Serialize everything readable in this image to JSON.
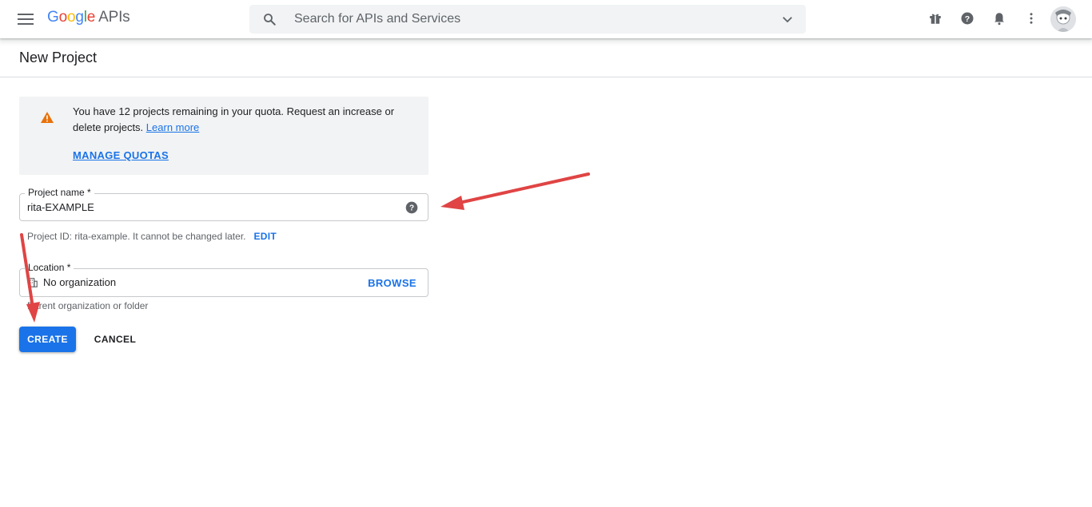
{
  "topbar": {
    "logo_letters": [
      "G",
      "o",
      "o",
      "g",
      "l",
      "e"
    ],
    "logo_suffix": "APIs",
    "search_placeholder": "Search for APIs and Services",
    "icons": [
      "menu-icon",
      "search-icon",
      "chevron-down-icon",
      "gift-icon",
      "help-icon",
      "notifications-icon",
      "more-vert-icon"
    ]
  },
  "page": {
    "title": "New Project"
  },
  "quota": {
    "message": "You have 12 projects remaining in your quota. Request an increase or delete projects.",
    "learn_more": "Learn more",
    "manage_quotas": "MANAGE QUOTAS"
  },
  "project_name": {
    "label": "Project name *",
    "value": "rita-EXAMPLE",
    "hint": "Project ID: rita-example. It cannot be changed later.",
    "edit": "EDIT"
  },
  "location": {
    "label": "Location *",
    "value": "No organization",
    "browse": "BROWSE",
    "hint": "Parent organization or folder"
  },
  "actions": {
    "create": "CREATE",
    "cancel": "CANCEL"
  },
  "colors": {
    "accent": "#1a73e8",
    "warning": "#e8710a",
    "annotation_arrow": "#e04444"
  }
}
